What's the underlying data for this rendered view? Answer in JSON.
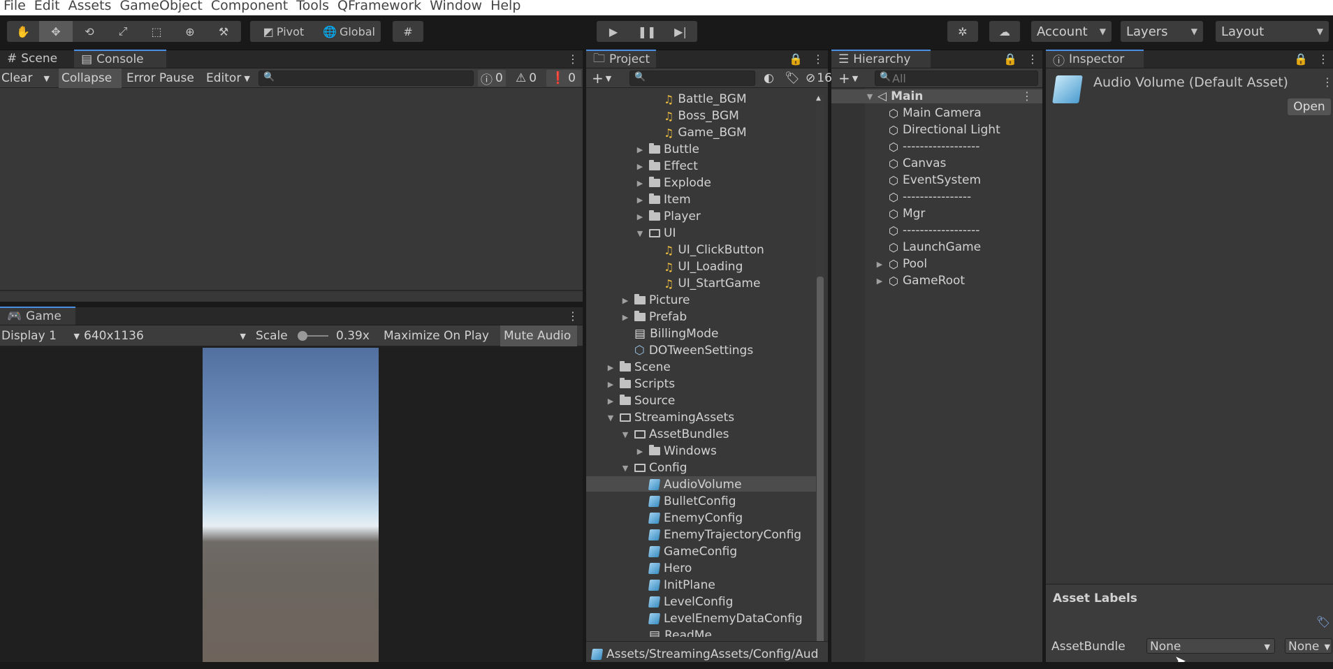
{
  "menu": [
    "File",
    "Edit",
    "Assets",
    "GameObject",
    "Component",
    "Tools",
    "QFramework",
    "Window",
    "Help"
  ],
  "toolbar": {
    "pivot": "Pivot",
    "global": "Global",
    "account": "Account",
    "layers": "Layers",
    "layout": "Layout"
  },
  "scene_panel": {
    "tab_scene": "Scene",
    "tab_console": "Console",
    "clear": "Clear",
    "collapse": "Collapse",
    "error_pause": "Error Pause",
    "editor": "Editor",
    "log_count": "0",
    "warn_count": "0",
    "error_count": "0"
  },
  "game_panel": {
    "tab": "Game",
    "display": "Display 1",
    "resolution": "640x1136",
    "scale_label": "Scale",
    "scale_value": "0.39x",
    "maximize": "Maximize On Play",
    "mute": "Mute Audio"
  },
  "project": {
    "tab": "Project",
    "hidden_count": "16",
    "path": "Assets/StreamingAssets/Config/Aud",
    "items": [
      {
        "label": "Battle_BGM",
        "icon": "audio-icon",
        "depth": 3,
        "arrow": ""
      },
      {
        "label": "Boss_BGM",
        "icon": "audio-icon",
        "depth": 3,
        "arrow": ""
      },
      {
        "label": "Game_BGM",
        "icon": "audio-icon",
        "depth": 3,
        "arrow": ""
      },
      {
        "label": "Buttle",
        "icon": "folder-icon",
        "depth": 2,
        "arrow": "▶"
      },
      {
        "label": "Effect",
        "icon": "folder-icon",
        "depth": 2,
        "arrow": "▶"
      },
      {
        "label": "Explode",
        "icon": "folder-icon",
        "depth": 2,
        "arrow": "▶"
      },
      {
        "label": "Item",
        "icon": "folder-icon",
        "depth": 2,
        "arrow": "▶"
      },
      {
        "label": "Player",
        "icon": "folder-icon",
        "depth": 2,
        "arrow": "▶"
      },
      {
        "label": "UI",
        "icon": "open-folder-icon",
        "depth": 2,
        "arrow": "▼"
      },
      {
        "label": "UI_ClickButton",
        "icon": "audio-icon",
        "depth": 3,
        "arrow": ""
      },
      {
        "label": "UI_Loading",
        "icon": "audio-icon",
        "depth": 3,
        "arrow": ""
      },
      {
        "label": "UI_StartGame",
        "icon": "audio-icon",
        "depth": 3,
        "arrow": ""
      },
      {
        "label": "Picture",
        "icon": "folder-icon",
        "depth": 1,
        "arrow": "▶"
      },
      {
        "label": "Prefab",
        "icon": "folder-icon",
        "depth": 1,
        "arrow": "▶"
      },
      {
        "label": "BillingMode",
        "icon": "doc-icon",
        "depth": 1,
        "arrow": ""
      },
      {
        "label": "DOTweenSettings",
        "icon": "settings-asset-icon",
        "depth": 1,
        "arrow": ""
      },
      {
        "label": "Scene",
        "icon": "folder-icon",
        "depth": 0,
        "arrow": "▶"
      },
      {
        "label": "Scripts",
        "icon": "folder-icon",
        "depth": 0,
        "arrow": "▶"
      },
      {
        "label": "Source",
        "icon": "folder-icon",
        "depth": 0,
        "arrow": "▶"
      },
      {
        "label": "StreamingAssets",
        "icon": "open-folder-icon",
        "depth": 0,
        "arrow": "▼"
      },
      {
        "label": "AssetBundles",
        "icon": "open-folder-icon",
        "depth": 1,
        "arrow": "▼"
      },
      {
        "label": "Windows",
        "icon": "folder-icon",
        "depth": 2,
        "arrow": "▶"
      },
      {
        "label": "Config",
        "icon": "open-folder-icon",
        "depth": 1,
        "arrow": "▼"
      },
      {
        "label": "AudioVolume",
        "icon": "scriptable-object-icon",
        "depth": 2,
        "arrow": "",
        "selected": true
      },
      {
        "label": "BulletConfig",
        "icon": "scriptable-object-icon",
        "depth": 2,
        "arrow": ""
      },
      {
        "label": "EnemyConfig",
        "icon": "scriptable-object-icon",
        "depth": 2,
        "arrow": ""
      },
      {
        "label": "EnemyTrajectoryConfig",
        "icon": "scriptable-object-icon",
        "depth": 2,
        "arrow": ""
      },
      {
        "label": "GameConfig",
        "icon": "scriptable-object-icon",
        "depth": 2,
        "arrow": ""
      },
      {
        "label": "Hero",
        "icon": "scriptable-object-icon",
        "depth": 2,
        "arrow": ""
      },
      {
        "label": "InitPlane",
        "icon": "scriptable-object-icon",
        "depth": 2,
        "arrow": ""
      },
      {
        "label": "LevelConfig",
        "icon": "scriptable-object-icon",
        "depth": 2,
        "arrow": ""
      },
      {
        "label": "LevelEnemyDataConfig",
        "icon": "scriptable-object-icon",
        "depth": 2,
        "arrow": ""
      },
      {
        "label": "ReadMe",
        "icon": "doc-icon",
        "depth": 2,
        "arrow": ""
      }
    ]
  },
  "hierarchy": {
    "tab": "Hierarchy",
    "search_placeholder": "All",
    "scene": "Main",
    "items": [
      {
        "label": "Main Camera",
        "arrow": ""
      },
      {
        "label": "Directional Light",
        "arrow": ""
      },
      {
        "label": "------------------",
        "arrow": ""
      },
      {
        "label": "Canvas",
        "arrow": ""
      },
      {
        "label": "EventSystem",
        "arrow": ""
      },
      {
        "label": "----------------",
        "arrow": ""
      },
      {
        "label": "Mgr",
        "arrow": ""
      },
      {
        "label": "------------------",
        "arrow": ""
      },
      {
        "label": "LaunchGame",
        "arrow": ""
      },
      {
        "label": "Pool",
        "arrow": "▶"
      },
      {
        "label": "GameRoot",
        "arrow": "▶"
      }
    ]
  },
  "inspector": {
    "tab": "Inspector",
    "title": "Audio Volume (Default Asset)",
    "open": "Open",
    "asset_labels": "Asset Labels",
    "assetbundle_label": "AssetBundle",
    "bundle_name": "None",
    "bundle_variant": "None"
  }
}
